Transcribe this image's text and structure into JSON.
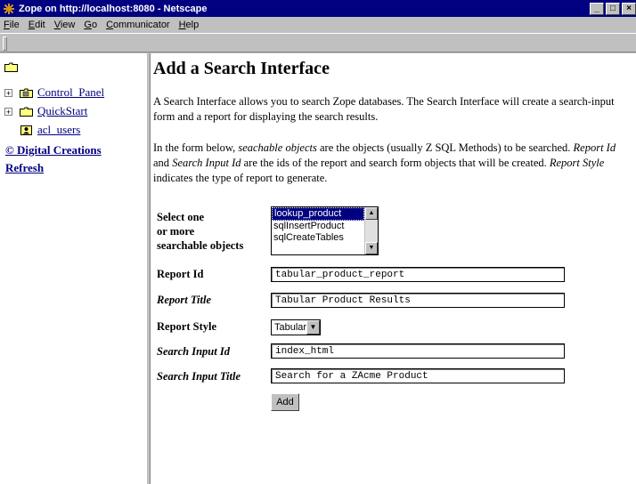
{
  "window": {
    "title": "Zope on http://localhost:8080 - Netscape",
    "buttons": [
      "_",
      "□",
      "×"
    ]
  },
  "menu": [
    {
      "pre": "",
      "u": "F",
      "post": "ile"
    },
    {
      "pre": "",
      "u": "E",
      "post": "dit"
    },
    {
      "pre": "",
      "u": "V",
      "post": "iew"
    },
    {
      "pre": "",
      "u": "G",
      "post": "o"
    },
    {
      "pre": "",
      "u": "C",
      "post": "ommunicator"
    },
    {
      "pre": "",
      "u": "H",
      "post": "elp"
    }
  ],
  "tree": {
    "items": [
      {
        "label": "Control_Panel",
        "expand": "+"
      },
      {
        "label": "QuickStart",
        "expand": "+"
      },
      {
        "label": "acl_users",
        "expand": ""
      }
    ],
    "digital_creations": "© Digital Creations",
    "refresh": "Refresh"
  },
  "main": {
    "heading": "Add a Search Interface",
    "intro": "A Search Interface allows you to search Zope databases. The Search Interface will create a search-input form and a report for displaying the search results.",
    "para2_parts": [
      "In the form below, ",
      "seachable objects",
      " are the objects (usually Z SQL Methods) to be searched. ",
      "Report Id",
      " and ",
      "Search Input Id",
      " are the ids of the report and search form objects that will be created. ",
      "Report Style",
      " indicates the type of report to generate."
    ],
    "labels": {
      "select_line1": "Select one",
      "select_line2": "or more",
      "select_line3": "searchable objects",
      "report_id": "Report Id",
      "report_title": "Report Title",
      "report_style": "Report Style",
      "search_input_id": "Search Input Id",
      "search_input_title": "Search Input Title"
    },
    "searchable_objects": [
      "lookup_product",
      "sqlInsertProduct",
      "sqlCreateTables"
    ],
    "selected_object": "lookup_product",
    "values": {
      "report_id": "tabular_product_report",
      "report_title": "Tabular Product Results",
      "report_style": "Tabular",
      "search_input_id": "index_html",
      "search_input_title": "Search for a ZAcme Product"
    },
    "add_button": "Add"
  }
}
